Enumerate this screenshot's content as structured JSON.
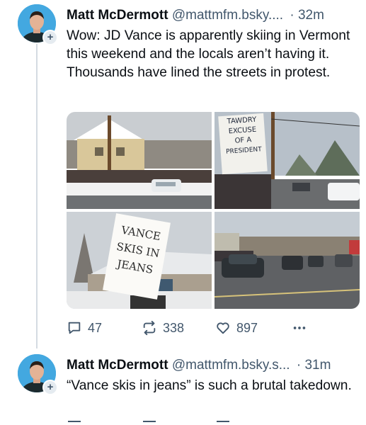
{
  "posts": [
    {
      "author": "Matt McDermott",
      "handle": "@mattmfm.bsky....",
      "separator": "·",
      "time": "32m",
      "text": "Wow: JD Vance is apparently skiing in Vermont this weekend and the locals aren’t having it. Thousands have lined the streets in protest.",
      "media": {
        "sign_top_right": [
          "TAWDRY",
          "EXCUSE",
          "OF A",
          "PRESIDENT"
        ],
        "sign_bottom_left": [
          "VANCE",
          "SKIS IN",
          "JEANS"
        ]
      },
      "actions": {
        "replies": "47",
        "reposts": "338",
        "likes": "897"
      }
    },
    {
      "author": "Matt McDermott",
      "handle": "@mattmfm.bsky.s...",
      "separator": "·",
      "time": "31m",
      "text": "“Vance skis in jeans” is such a brutal takedown."
    }
  ],
  "icons": {
    "reply": "speech-bubble",
    "repost": "two-arrows-loop",
    "like": "heart-outline",
    "more": "ellipsis"
  },
  "colors": {
    "muted": "#42576c",
    "thread_line": "#d4dbe2",
    "avatar_bg": "#43a8e0"
  }
}
